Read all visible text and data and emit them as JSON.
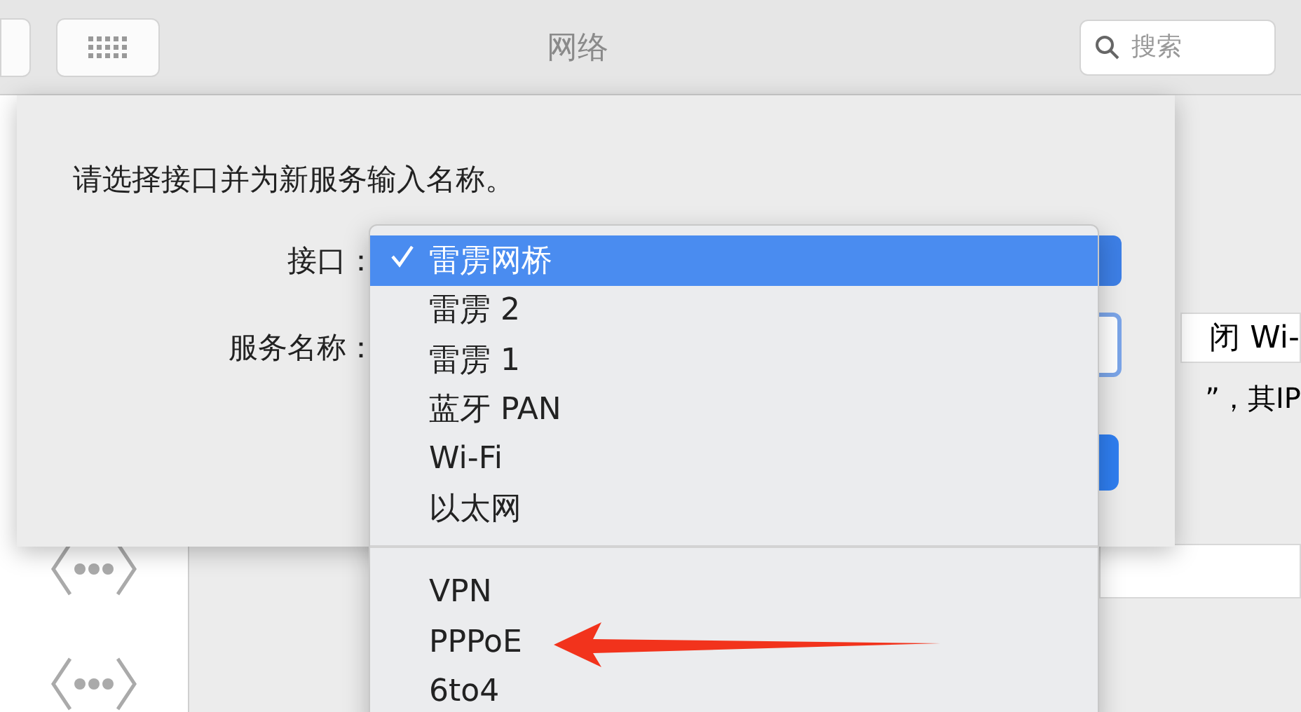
{
  "window": {
    "title": "网络"
  },
  "search": {
    "placeholder": "搜索"
  },
  "background_panel": {
    "field_value": "闭 Wi-",
    "note": "”，其IP"
  },
  "sheet": {
    "prompt": "请选择接口并为新服务输入名称。",
    "interface_label": "接口：",
    "service_name_label": "服务名称："
  },
  "interface_menu": {
    "groups": [
      [
        {
          "label": "雷雳网桥",
          "selected": true
        },
        {
          "label": "雷雳 2",
          "selected": false
        },
        {
          "label": "雷雳 1",
          "selected": false
        },
        {
          "label": "蓝牙 PAN",
          "selected": false
        },
        {
          "label": "Wi-Fi",
          "selected": false
        },
        {
          "label": "以太网",
          "selected": false
        }
      ],
      [
        {
          "label": "VPN",
          "selected": false
        },
        {
          "label": "PPPoE",
          "selected": false
        },
        {
          "label": "6to4",
          "selected": false
        }
      ]
    ]
  }
}
